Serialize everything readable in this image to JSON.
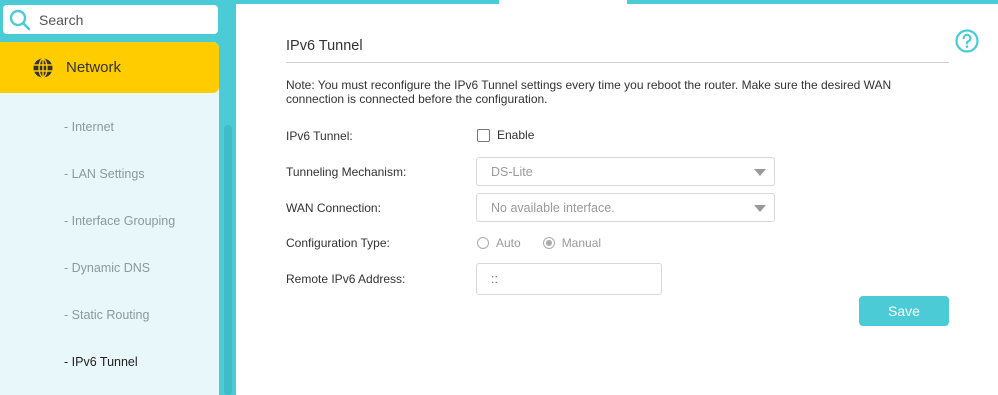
{
  "search": {
    "placeholder": "Search"
  },
  "sidebar": {
    "section_label": "Network",
    "items": [
      {
        "label": "- Internet",
        "active": false
      },
      {
        "label": "- LAN Settings",
        "active": false
      },
      {
        "label": "- Interface Grouping",
        "active": false
      },
      {
        "label": "- Dynamic DNS",
        "active": false
      },
      {
        "label": "- Static Routing",
        "active": false
      },
      {
        "label": "- IPv6 Tunnel",
        "active": true
      }
    ]
  },
  "main": {
    "title": "IPv6 Tunnel",
    "note": "Note: You must reconfigure the IPv6 Tunnel settings every time you reboot the router. Make sure the desired WAN connection is connected before the configuration.",
    "fields": {
      "ipv6_tunnel_label": "IPv6 Tunnel:",
      "enable_label": "Enable",
      "enable_checked": false,
      "mechanism_label": "Tunneling Mechanism:",
      "mechanism_value": "DS-Lite",
      "wan_label": "WAN Connection:",
      "wan_value": "No available interface.",
      "config_type_label": "Configuration Type:",
      "config_options": [
        {
          "label": "Auto",
          "selected": false
        },
        {
          "label": "Manual",
          "selected": true
        }
      ],
      "remote_label": "Remote IPv6 Address:",
      "remote_value": "::"
    },
    "save_label": "Save"
  },
  "colors": {
    "accent": "#4acbd6",
    "highlight": "#ffcc00",
    "panel": "#e8f7f9"
  },
  "icons": {
    "search": "search-icon",
    "network": "globe-icon",
    "help": "help-icon"
  }
}
